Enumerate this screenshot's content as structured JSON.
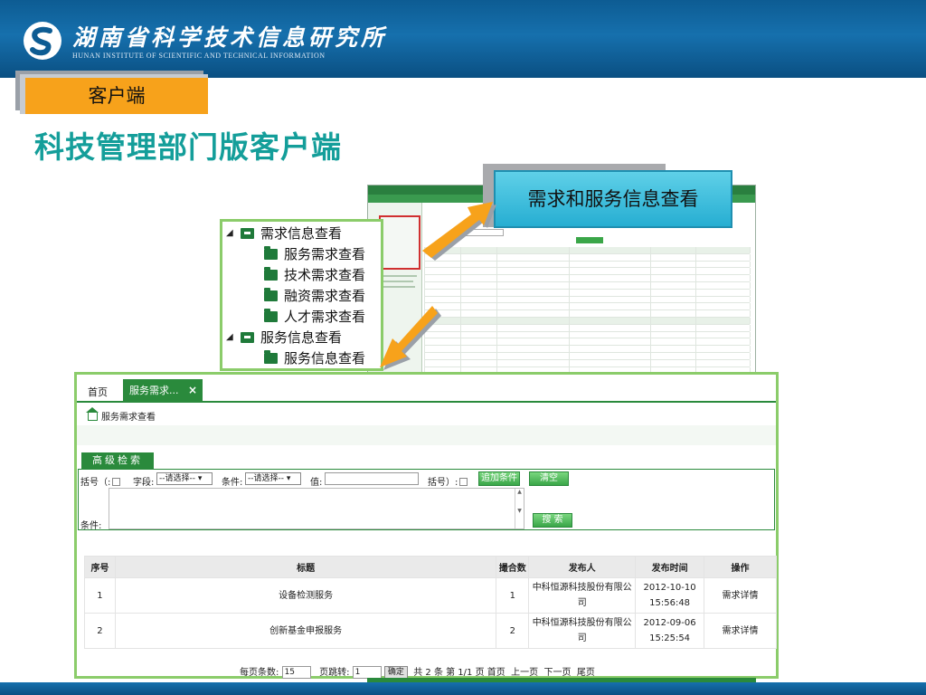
{
  "header": {
    "org_name_cn": "湖南省科学技术信息研究所",
    "org_name_en": "HUNAN INSTITUTE OF SCIENTIFIC AND TECHNICAL INFORMATION"
  },
  "section_tab": "客户端",
  "page_title": "科技管理部门版客户端",
  "callout": "需求和服务信息查看",
  "tree": {
    "groups": [
      {
        "label": "需求信息查看",
        "items": [
          "服务需求查看",
          "技术需求查看",
          "融资需求查看",
          "人才需求查看"
        ]
      },
      {
        "label": "服务信息查看",
        "items": [
          "服务信息查看"
        ]
      }
    ]
  },
  "app": {
    "tabs": {
      "home": "首页",
      "active": "服务需求...",
      "close": "×"
    },
    "breadcrumb": "服务需求查看",
    "advanced_search": "高级检索",
    "filter": {
      "bracket_open": "括号（:",
      "field_label": "字段:",
      "field_select": "--请选择--",
      "condition_label": "条件:",
      "condition_select": "--请选择--",
      "value_label": "值:",
      "bracket_close": "括号）:",
      "add_condition": "追加条件",
      "clear": "清空",
      "conditions_label": "条件:",
      "search": "搜 索"
    },
    "table": {
      "headers": [
        "序号",
        "标题",
        "撮合数",
        "发布人",
        "发布时间",
        "操作"
      ],
      "rows": [
        [
          "1",
          "设备检测服务",
          "1",
          "中科恒源科技股份有限公司",
          "2012-10-10 15:56:48",
          "需求详情"
        ],
        [
          "2",
          "创新基金申报服务",
          "2",
          "中科恒源科技股份有限公司",
          "2012-09-06 15:25:54",
          "需求详情"
        ]
      ]
    },
    "pager": {
      "per_page_label": "每页条数:",
      "per_page_value": "15",
      "jump_label": "页跳转:",
      "jump_value": "1",
      "confirm": "确定",
      "summary": "共 2 条 第 1/1 页",
      "first": "首页",
      "prev": "上一页",
      "next": "下一页",
      "last": "尾页"
    }
  }
}
